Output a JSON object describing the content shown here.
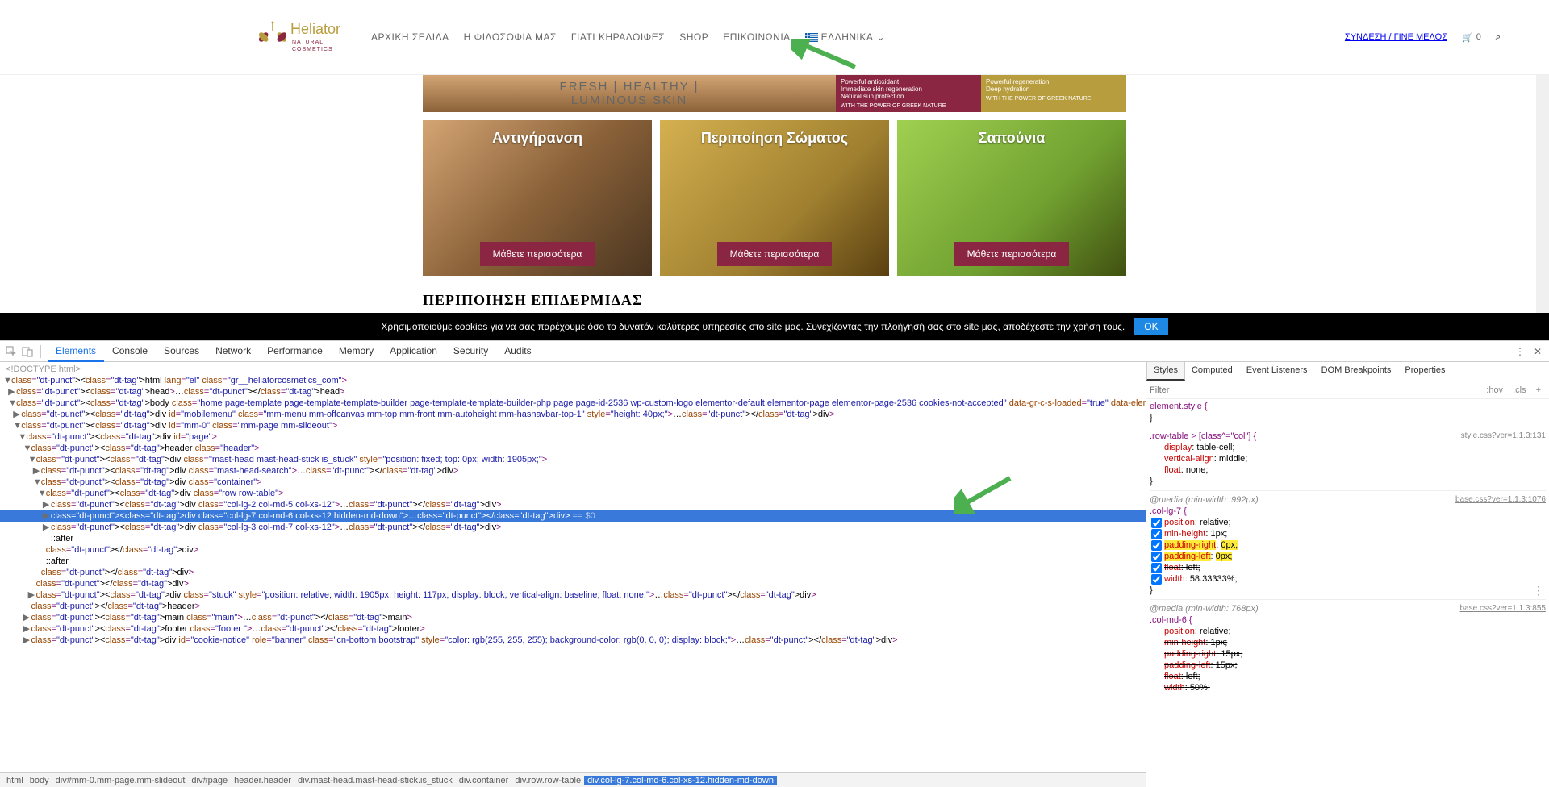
{
  "logo": {
    "brand": "Heliator",
    "line1": "NATURAL",
    "line2": "COSMETICS"
  },
  "nav": {
    "items": [
      "ΑΡΧΙΚΗ ΣΕΛΙΔΑ",
      "Η ΦΙΛΟΣΟΦΙΑ ΜΑΣ",
      "ΓΙΑΤΙ ΚΗΡΑΛΟΙΦΕΣ",
      "SHOP",
      "ΕΠΙΚΟΙΝΩΝΙΑ"
    ],
    "lang": "ΕΛΛΗΝΙΚΑ"
  },
  "rightnav": {
    "login": "ΣΥΝΔΕΣΗ / ΓΙΝΕ ΜΕΛΟΣ",
    "cart_count": "0"
  },
  "hero": {
    "line1": "FRESH | HEALTHY |",
    "line2": "LUMINOUS SKIN",
    "mid1": "Powerful antioxidant",
    "mid2": "Immediate skin regeneration",
    "mid3": "Natural sun protection",
    "mid_bottom": "WITH THE POWER OF GREEK NATURE",
    "right1": "Powerful regeneration",
    "right2": "Deep hydration",
    "right_bottom": "WITH THE POWER OF GREEK NATURE"
  },
  "cards": [
    {
      "title": "Αντιγήρανση",
      "btn": "Μάθετε περισσότερα"
    },
    {
      "title": "Περιποίηση Σώματος",
      "btn": "Μάθετε περισσότερα"
    },
    {
      "title": "Σαπούνια",
      "btn": "Μάθετε περισσότερα"
    }
  ],
  "section_title": "ΠΕΡΙΠΟΙΗΣΗ ΕΠΙΔΕΡΜΙΔΑΣ",
  "cookie": {
    "text": "Χρησιμοποιούμε cookies για να σας παρέχουμε όσο το δυνατόν καλύτερες υπηρεσίες στο site μας. Συνεχίζοντας την πλοήγησή σας στο site μας, αποδέχεστε την χρήση τους.",
    "btn": "OK"
  },
  "devtools": {
    "tabs": [
      "Elements",
      "Console",
      "Sources",
      "Network",
      "Performance",
      "Memory",
      "Application",
      "Security",
      "Audits"
    ],
    "styles_tabs": [
      "Styles",
      "Computed",
      "Event Listeners",
      "DOM Breakpoints",
      "Properties"
    ],
    "filter_placeholder": "Filter",
    "hov": ":hov",
    "cls": ".cls",
    "elements": {
      "doctype": "<!DOCTYPE html>",
      "html": "<html lang=\"el\" class=\"gr__heliatorcosmetics_com\">",
      "head": "<head>…</head>",
      "body": "<body class=\"home page-template page-template-template-builder page-template-template-builder-php page page-id-2536 wp-custom-logo elementor-default elementor-page elementor-page-2536 cookies-not-accepted\" data-gr-c-s-loaded=\"true\" data-elementor-device-mode=\"desktop\">",
      "mobilemenu": "<div id=\"mobilemenu\" class=\"mm-menu mm-offcanvas mm-top mm-front mm-autoheight mm-hasnavbar-top-1\" style=\"height: 40px;\">…</div>",
      "mm0": "<div id=\"mm-0\" class=\"mm-page mm-slideout\">",
      "page": "<div id=\"page\">",
      "header": "<header class=\"header\">",
      "masthead": "<div class=\"mast-head mast-head-stick is_stuck\" style=\"position: fixed; top: 0px; width: 1905px;\">",
      "search": "<div class=\"mast-head-search\">…</div>",
      "container": "<div class=\"container\">",
      "row": "<div class=\"row row-table\">",
      "col1": "<div class=\"col-lg-2 col-md-5 col-xs-12\">…</div>",
      "col2": "<div class=\"col-lg-7 col-md-6 col-xs-12 hidden-md-down\">…</div> == $0",
      "col3": "<div class=\"col-lg-3 col-md-7 col-xs-12\">…</div>",
      "after1": "::after",
      "divclose1": "</div>",
      "after2": "::after",
      "divclose2": "</div>",
      "divclose3": "</div>",
      "stuck": "<div class=\"stuck\" style=\"position: relative; width: 1905px; height: 117px; display: block; vertical-align: baseline; float: none;\">…</div>",
      "headerclose": "</header>",
      "main": "<main class=\"main\">…</main>",
      "footer": "<footer class=\"footer \">…</footer>",
      "cookienotice": "<div id=\"cookie-notice\" role=\"banner\" class=\"cn-bottom bootstrap\" style=\"color: rgb(255, 255, 255); background-color: rgb(0, 0, 0); display: block;\">…</div>"
    },
    "breadcrumb": [
      "html",
      "body",
      "div#mm-0.mm-page.mm-slideout",
      "div#page",
      "header.header",
      "div.mast-head.mast-head-stick.is_stuck",
      "div.container",
      "div.row.row-table",
      "div.col-lg-7.col-md-6.col-xs-12.hidden-md-down"
    ],
    "styles": {
      "element_style": "element.style {",
      "rule1": {
        "selector": ".row-table > [class^=\"col\"] {",
        "link": "style.css?ver=1.1.3:131",
        "decls": [
          {
            "prop": "display",
            "val": "table-cell;"
          },
          {
            "prop": "vertical-align",
            "val": "middle;"
          },
          {
            "prop": "float",
            "val": "none;"
          }
        ]
      },
      "rule2": {
        "media": "@media (min-width: 992px)",
        "selector": ".col-lg-7 {",
        "link": "base.css?ver=1.1.3:1076",
        "decls": [
          {
            "prop": "position",
            "val": "relative;",
            "hl": false
          },
          {
            "prop": "min-height",
            "val": "1px;",
            "hl": false
          },
          {
            "prop": "padding-right",
            "val": "0px;",
            "hl": true
          },
          {
            "prop": "padding-left",
            "val": "0px;",
            "hl": true
          },
          {
            "prop": "float",
            "val": "left;",
            "strike": true
          },
          {
            "prop": "width",
            "val": "58.33333%;"
          }
        ]
      },
      "rule3": {
        "media": "@media (min-width: 768px)",
        "selector": ".col-md-6 {",
        "link": "base.css?ver=1.1.3:855",
        "decls": [
          {
            "prop": "position",
            "val": "relative;",
            "strike": true
          },
          {
            "prop": "min-height",
            "val": "1px;",
            "strike": true
          },
          {
            "prop": "padding-right",
            "val": "15px;",
            "strike": true
          },
          {
            "prop": "padding-left",
            "val": "15px;",
            "strike": true
          },
          {
            "prop": "float",
            "val": "left;",
            "strike": true
          },
          {
            "prop": "width",
            "val": "50%;",
            "strike": true
          }
        ]
      }
    }
  }
}
